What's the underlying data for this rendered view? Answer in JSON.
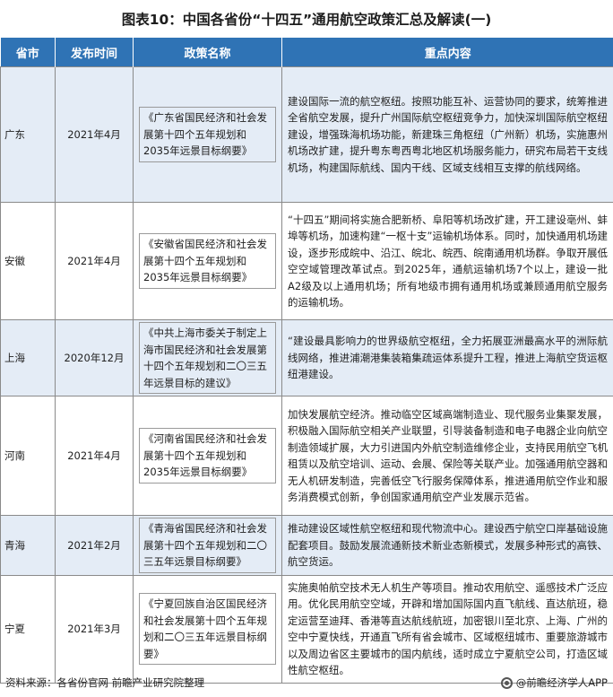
{
  "title": "图表10：中国各省份“十四五”通用航空政策汇总及解读(一)",
  "columns": [
    "省市",
    "发布时间",
    "政策名称",
    "重点内容"
  ],
  "rows": [
    {
      "province": "广东",
      "date": "2021年4月",
      "policy": "《广东省国民经济和社会发展第十四个五年规划和2035年远景目标纲要》",
      "content": "建设国际一流的航空枢纽。按照功能互补、运营协同的要求，统筹推进全省航空发展，提升广州国际航空枢纽竞争力，加快深圳国际航空枢纽建设，增强珠海机场功能，新建珠三角枢纽（广州新）机场，实施惠州机场改扩建，提升粤东粤西粤北地区机场服务能力，研究布局若干支线机场，构建国际航线、国内干线、区域支线相互支撑的航线网络。"
    },
    {
      "province": "安徽",
      "date": "2021年4月",
      "policy": "《安徽省国民经济和社会发展第十四个五年规划和2035年远景目标纲要》",
      "content": "“十四五”期间将实施合肥新桥、阜阳等机场改扩建，开工建设亳州、蚌埠等机场，加速构建“一枢十支”运输机场体系。同时，加快通用机场建设，逐步形成皖中、沿江、皖北、皖西、皖南通用机场群。争取开展低空空域管理改革试点。到2025年，通航运输机场7个以上，建设一批A2级及以上通用机场；所有地级市拥有通用机场或兼顾通用航空服务的运输机场。"
    },
    {
      "province": "上海",
      "date": "2020年12月",
      "policy": "《中共上海市委关于制定上海市国民经济和社会发展第十四个五年规划和二〇三五年远景目标的建议》",
      "content": "“建设最具影响力的世界级航空枢纽，全力拓展亚洲最高水平的洲际航线网络，推进浦潮港集装箱集疏运体系提升工程，推进上海航空货运枢纽港建设。"
    },
    {
      "province": "河南",
      "date": "2021年4月",
      "policy": "《河南省国民经济和社会发展第十四个五年规划和2035年远景目标纲要》",
      "content": "加快发展航空经济。推动临空区域高端制造业、现代服务业集聚发展，积极融入国际航空相关产业联盟，引导装备制造和电子电器企业向航空制造领域扩展，大力引进国内外航空制造维修企业，支持民用航空飞机租赁以及航空培训、运动、会展、保险等关联产业。加强通用航空器和无人机研发制造，完善低空飞行服务保障体系，推进通用航空作业和服务消费模式创新，争创国家通用航空产业发展示范省。"
    },
    {
      "province": "青海",
      "date": "2021年2月",
      "policy": "《青海省国民经济和社会发展第十四个五年规划和二〇三五年远景目标纲要》",
      "content": "推动建设区域性航空枢纽和现代物流中心。建设西宁航空口岸基础设施配套项目。鼓励发展流通新技术新业态新模式，发展多种形式的高铁、航空货运。"
    },
    {
      "province": "宁夏",
      "date": "2021年3月",
      "policy": "《宁夏回族自治区国民经济和社会发展第十四个五年规划和二〇三五年远景目标纲要》",
      "content": "实施奥帕航空技术无人机生产等项目。推动农用航空、遥感技术广泛应用。优化民用航空空域，开辟和增加国际国内直飞航线、直达航班，稳定运营至迪拜、香港等直达航线航班，加密银川至北京、上海、广州的空中宁夏快线，开通直飞所有省会城市、区域枢纽城市、重要旅游城市以及周边省区主要城市的国内航线，适时成立宁夏航空公司，打造区域性航空枢纽。"
    }
  ],
  "footer": {
    "source": "资料来源：各省份官网 前瞻产业研究院整理",
    "brand": "@前瞻经济学人APP",
    "brand_icon": "qianzhan-logo-icon"
  }
}
